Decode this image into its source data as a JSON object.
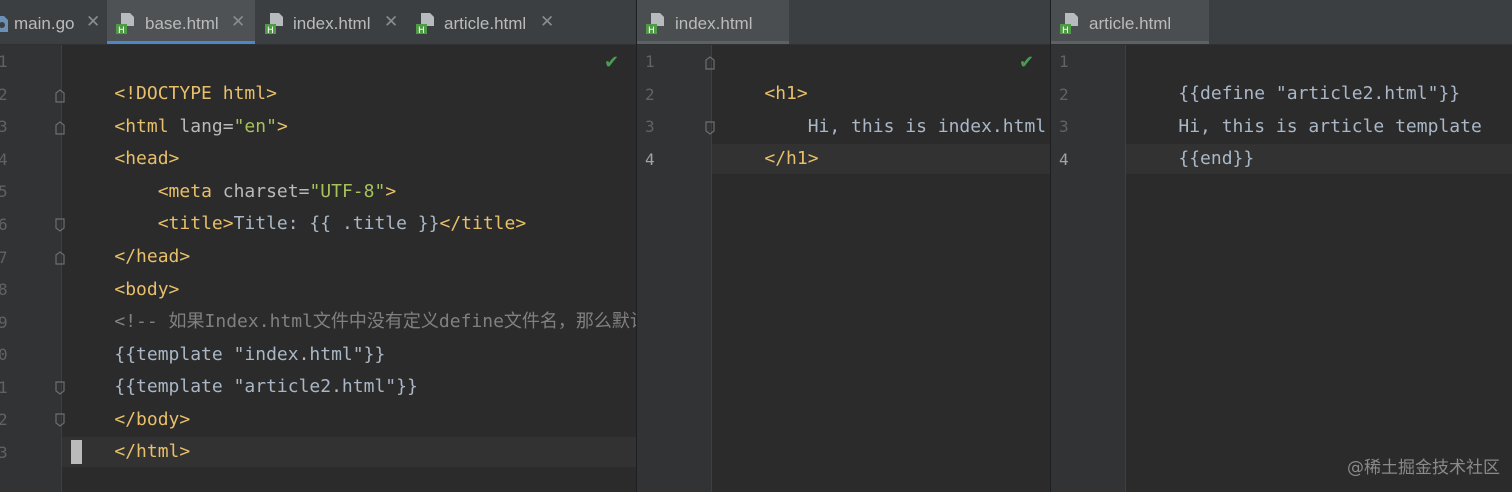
{
  "left_pane": {
    "tabs": [
      {
        "label": "main.go",
        "icon": "go-file-icon",
        "active": false
      },
      {
        "label": "base.html",
        "icon": "html-file-icon",
        "active": true
      },
      {
        "label": "index.html",
        "icon": "html-file-icon",
        "active": false
      },
      {
        "label": "article.html",
        "icon": "html-file-icon",
        "active": false
      }
    ],
    "line_numbers": [
      "1",
      "2",
      "3",
      "4",
      "5",
      "6",
      "7",
      "8",
      "9",
      "0",
      "1",
      "2",
      "3"
    ],
    "lines": [
      [
        "<!DOCTYPE html>"
      ],
      [
        "<html ",
        "lang=",
        "\"en\"",
        ">"
      ],
      [
        "<head>"
      ],
      [
        "    ",
        "<meta ",
        "charset=",
        "\"UTF-8\"",
        ">"
      ],
      [
        "    ",
        "<title>",
        "Title: {{ .title }}",
        "</title>"
      ],
      [
        "</head>"
      ],
      [
        "<body>"
      ],
      [
        "<!-- 如果Index.html文件中没有定义define文件名，那么默认"
      ],
      [
        "{{template \"index.html\"}}"
      ],
      [
        "{{template \"article2.html\"}}"
      ],
      [
        "</body>"
      ],
      [
        "</html>"
      ]
    ]
  },
  "middle_pane": {
    "tabs": [
      {
        "label": "index.html",
        "icon": "html-file-icon",
        "active": true
      }
    ],
    "line_numbers": [
      "1",
      "2",
      "3",
      "4"
    ],
    "lines": [
      [
        "<h1>"
      ],
      [
        "    Hi, this is index.html"
      ],
      [
        "</h1>"
      ],
      [
        ""
      ]
    ]
  },
  "right_pane": {
    "tabs": [
      {
        "label": "article.html",
        "icon": "html-file-icon",
        "active": true
      }
    ],
    "line_numbers": [
      "1",
      "2",
      "3",
      "4"
    ],
    "lines": [
      [
        "{{define \"article2.html\"}}"
      ],
      [
        "Hi, this is article template"
      ],
      [
        "{{end}}"
      ],
      [
        ""
      ]
    ]
  },
  "close_glyph": "✕",
  "check_glyph": "✔",
  "watermark": "@稀土掘金技术社区",
  "colors": {
    "tag": "#e8bf6a",
    "attr": "#bababa",
    "value": "#a5c25c",
    "comment": "#808080",
    "text": "#a9b7c6",
    "active_tab_underline": "#4a88c7",
    "check": "#499c54"
  }
}
